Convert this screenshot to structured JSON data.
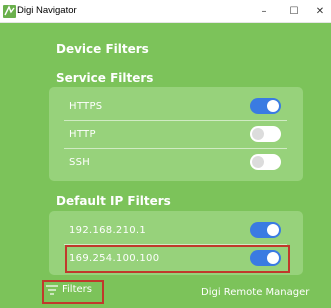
{
  "window": {
    "title": "Digi Navigator",
    "minimize_glyph": "–",
    "maximize_glyph": "☐",
    "close_glyph": "✕"
  },
  "sections": {
    "device_filters": "Device Filters",
    "service_filters": "Service Filters",
    "default_ip_filters": "Default IP Filters"
  },
  "service_filters": [
    {
      "label": "HTTPS",
      "enabled": true
    },
    {
      "label": "HTTP",
      "enabled": false
    },
    {
      "label": "SSH",
      "enabled": false
    }
  ],
  "ip_filters": [
    {
      "label": "192.168.210.1",
      "enabled": true
    },
    {
      "label": "169.254.100.100",
      "enabled": true
    }
  ],
  "footer": {
    "filters_label": "Filters",
    "filters_icon": "filter-lines-icon",
    "remote_manager_label": "Digi Remote Manager"
  },
  "colors": {
    "background": "#7cc35a",
    "panel": "#97d27b",
    "toggle_on": "#3a7be2",
    "highlight": "#c0392b"
  }
}
